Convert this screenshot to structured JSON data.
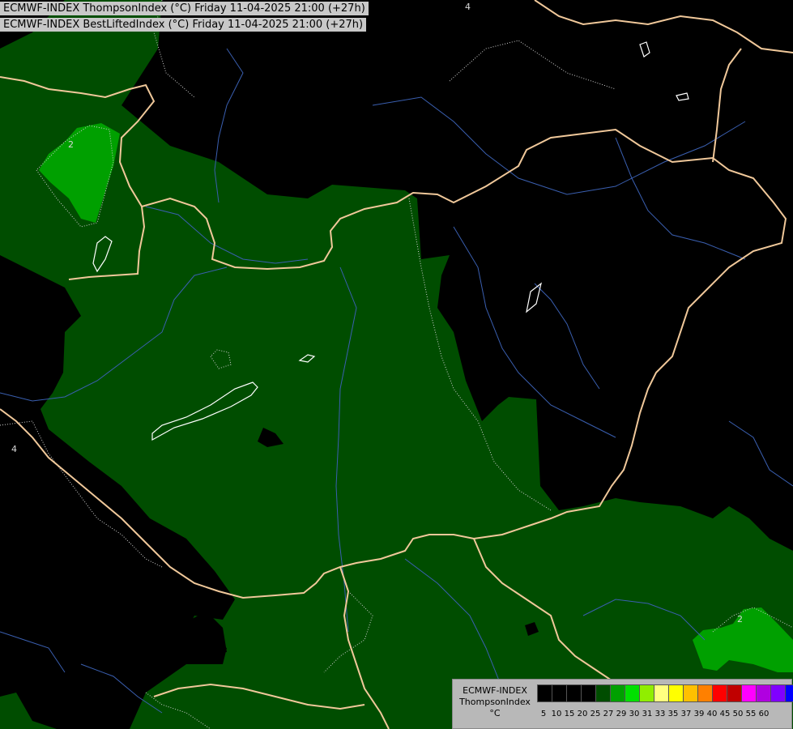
{
  "header": {
    "line1": "ECMWF-INDEX ThompsonIndex (°C) Friday 11-04-2025 21:00 (+27h)",
    "line2": "ECMWF-INDEX BestLiftedIndex (°C) Friday 11-04-2025 21:00 (+27h)"
  },
  "legend": {
    "line1": "ECMWF-INDEX",
    "line2": "ThompsonIndex",
    "line3": "°C",
    "swatches": [
      "#000000",
      "#000000",
      "#000000",
      "#000000",
      "#004d00",
      "#00a000",
      "#00e000",
      "#90ee00",
      "#ffff80",
      "#ffff00",
      "#ffc000",
      "#ff8000",
      "#ff0000",
      "#c00000",
      "#ff00ff",
      "#b000e0",
      "#8000ff",
      "#0000ff"
    ],
    "ticks": [
      "5",
      "10",
      "15",
      "20",
      "25",
      "27",
      "29",
      "30",
      "31",
      "33",
      "35",
      "37",
      "39",
      "40",
      "45",
      "50",
      "55",
      "60"
    ]
  },
  "map_labels": {
    "contour_2_nw": "2",
    "contour_2_se": "2",
    "contour_4_w": "4",
    "contour_4_n": "4"
  },
  "colors": {
    "background": "#000000",
    "dark_green": "#004d00",
    "mid_green": "#00a000",
    "border": "#f0c89a",
    "river": "#3a5fb0"
  }
}
